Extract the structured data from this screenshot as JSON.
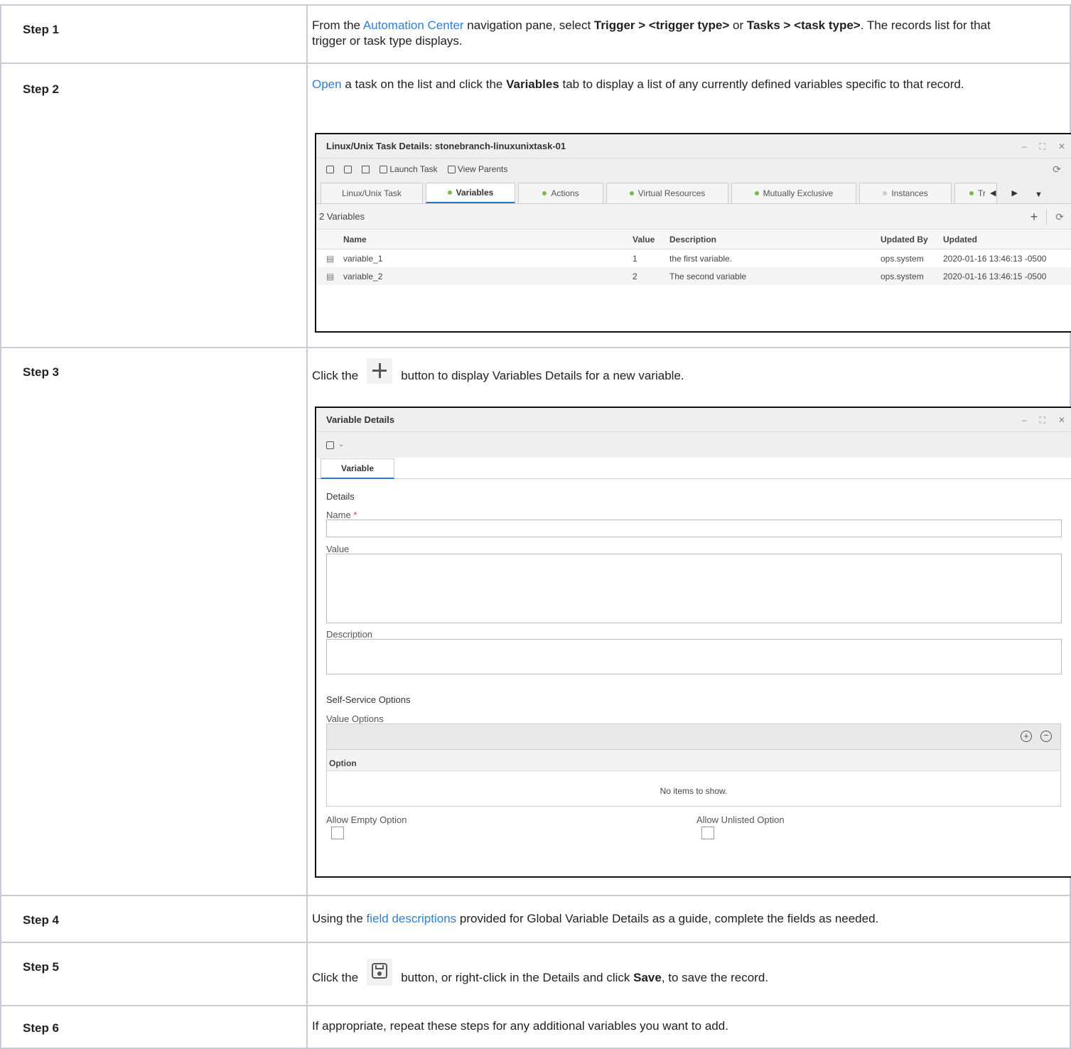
{
  "steps": [
    {
      "label": "Step 1",
      "parts": [
        {
          "t": "From the "
        },
        {
          "t": "Automation Center",
          "link": true
        },
        {
          "t": " navigation pane, select "
        },
        {
          "t": "Trigger > <trigger type>",
          "bold": true
        },
        {
          "t": " or "
        },
        {
          "t": "Tasks > <task type>",
          "bold": true
        },
        {
          "t": ". The records list for that trigger or task type displays."
        }
      ]
    },
    {
      "label": "Step 2",
      "parts": [
        {
          "t": "Open",
          "link": true
        },
        {
          "t": " a task on the list and click the "
        },
        {
          "t": "Variables",
          "bold": true
        },
        {
          "t": " tab to display a list of any currently defined variables specific to that record."
        }
      ]
    },
    {
      "label": "Step 3",
      "text_before": "Click the",
      "text_after": "button to display Variables Details for a new variable."
    },
    {
      "label": "Step 4",
      "parts": [
        {
          "t": "Using the "
        },
        {
          "t": "field descriptions",
          "link": true
        },
        {
          "t": " provided for Global Variable Details as a guide, complete the fields as needed."
        }
      ]
    },
    {
      "label": "Step 5",
      "text_before": "Click the",
      "text_middle": "button, or right-click in the Details and click ",
      "bold_word": "Save",
      "text_after": ", to save the record."
    },
    {
      "label": "Step 6",
      "parts": [
        {
          "t": "If appropriate, repeat these steps for any additional variables you want to add."
        }
      ]
    }
  ],
  "task_window": {
    "title": "Linux/Unix Task Details: stonebranch-linuxunixtask-01",
    "toolbar": {
      "launch": "Launch Task",
      "view_parents": "View Parents"
    },
    "tabs": [
      {
        "label": "Linux/Unix Task",
        "dot": "none"
      },
      {
        "label": "Variables",
        "dot": "green",
        "active": true
      },
      {
        "label": "Actions",
        "dot": "green"
      },
      {
        "label": "Virtual Resources",
        "dot": "green"
      },
      {
        "label": "Mutually Exclusive",
        "dot": "green"
      },
      {
        "label": "Instances",
        "dot": "grey"
      },
      {
        "label": "Tr",
        "dot": "green"
      }
    ],
    "count": "2 Variables",
    "columns": {
      "name": "Name",
      "value": "Value",
      "description": "Description",
      "updated_by": "Updated By",
      "updated": "Updated"
    },
    "rows": [
      {
        "name": "variable_1",
        "value": "1",
        "description": "the first variable.",
        "updated_by": "ops.system",
        "updated": "2020-01-16 13:46:13 -0500"
      },
      {
        "name": "variable_2",
        "value": "2",
        "description": "The second variable",
        "updated_by": "ops.system",
        "updated": "2020-01-16 13:46:15 -0500"
      }
    ]
  },
  "variable_window": {
    "title": "Variable Details",
    "tab": "Variable",
    "details_heading": "Details",
    "name_label": "Name",
    "required_mark": "*",
    "value_label": "Value",
    "description_label": "Description",
    "self_service_heading": "Self-Service Options",
    "value_options_label": "Value Options",
    "option_column": "Option",
    "no_items": "No items to show.",
    "allow_empty": "Allow Empty Option",
    "allow_unlisted": "Allow Unlisted Option"
  }
}
